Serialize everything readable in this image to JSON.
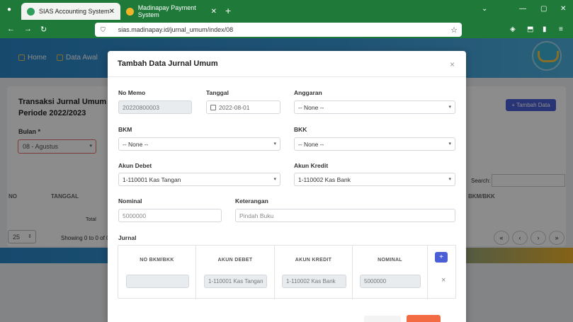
{
  "browser": {
    "tabs": [
      {
        "title": "SIAS Accounting System",
        "active": true
      },
      {
        "title": "Madinapay Payment System",
        "active": false
      }
    ],
    "url": "sias.madinapay.id/jurnal_umum/index/08"
  },
  "app": {
    "nav": [
      {
        "label": "Home",
        "icon": "home-icon"
      },
      {
        "label": "Data Awal",
        "icon": "monitor-icon"
      }
    ]
  },
  "page": {
    "title": "Transaksi Jurnal Umum",
    "period": "Periode 2022/2023",
    "bulan_label": "Bulan *",
    "bulan_value": "08 - Agustus",
    "add_button": "+ Tambah Data",
    "search_label": "Search:",
    "columns": {
      "no": "NO",
      "tanggal": "TANGGAL",
      "bkm_bkk": "BKM/BKK"
    },
    "total_label": "Total",
    "per_page": "25",
    "showing": "Showing 0 to 0 of 0"
  },
  "modal": {
    "title": "Tambah Data Jurnal Umum",
    "close": "×",
    "fields": {
      "no_memo": {
        "label": "No Memo",
        "value": "20220800003"
      },
      "tanggal": {
        "label": "Tanggal",
        "value": "2022-08-01"
      },
      "anggaran": {
        "label": "Anggaran",
        "value": "-- None --"
      },
      "bkm": {
        "label": "BKM",
        "value": "-- None --"
      },
      "bkk": {
        "label": "BKK",
        "value": "-- None --"
      },
      "akun_debet": {
        "label": "Akun Debet",
        "value": "1-110001 Kas Tangan"
      },
      "akun_kredit": {
        "label": "Akun Kredit",
        "value": "1-110002 Kas Bank"
      },
      "nominal": {
        "label": "Nominal",
        "placeholder": "5000000"
      },
      "keterangan": {
        "label": "Keterangan",
        "placeholder": "Pindah Buku"
      }
    },
    "jurnal": {
      "label": "Jurnal",
      "headers": [
        "NO BKM/BKK",
        "AKUN DEBET",
        "AKUN KREDIT",
        "NOMINAL"
      ],
      "row": {
        "no_bkm_bkk": "",
        "akun_debet": "1-110001 Kas Tangan",
        "akun_kredit": "1-110002 Kas Bank",
        "nominal": "5000000"
      },
      "add": "+",
      "remove": "×"
    }
  },
  "colors": {
    "browser_green": "#1f7a3a",
    "header_blue": "#2a86c7",
    "primary": "#4a5fd6",
    "danger": "#f26b43"
  }
}
